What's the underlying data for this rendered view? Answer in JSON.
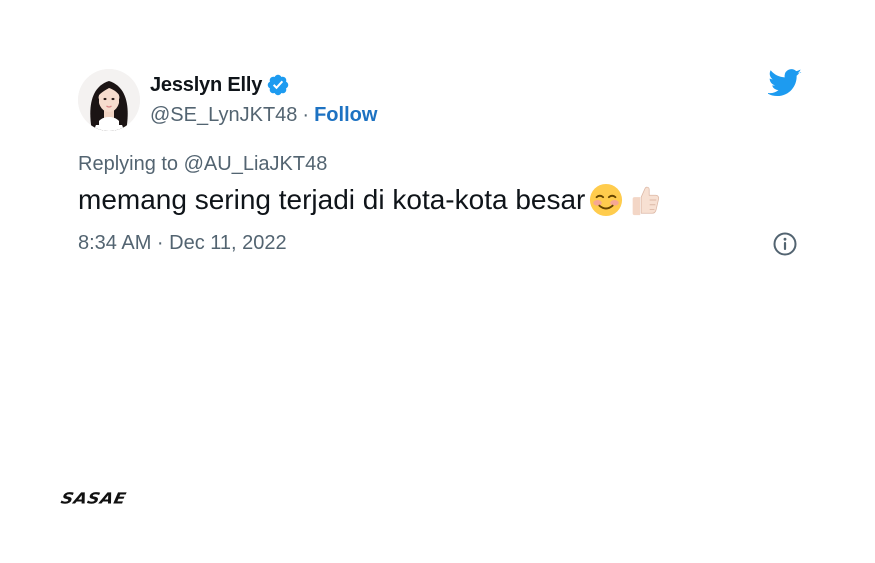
{
  "tweet": {
    "display_name": "Jesslyn Elly",
    "handle": "@SE_LynJKT48",
    "separator": "·",
    "follow_label": "Follow",
    "replying_to": "Replying to @AU_LiaJKT48",
    "text": "memang sering terjadi di kota-kota besar",
    "emojis": [
      "smiling-face-with-blush",
      "thumbs-up-light-skin"
    ],
    "timestamp": "8:34 AM · Dec 11, 2022"
  },
  "brand": {
    "label": "SASAE"
  },
  "icons": {
    "verified": "verified-badge-icon",
    "twitter": "twitter-bird-icon",
    "info": "info-icon"
  },
  "colors": {
    "twitter_blue": "#1d9bf0",
    "follow_link": "#1d72c2",
    "muted_text": "#536471",
    "primary_text": "#0f1419"
  }
}
